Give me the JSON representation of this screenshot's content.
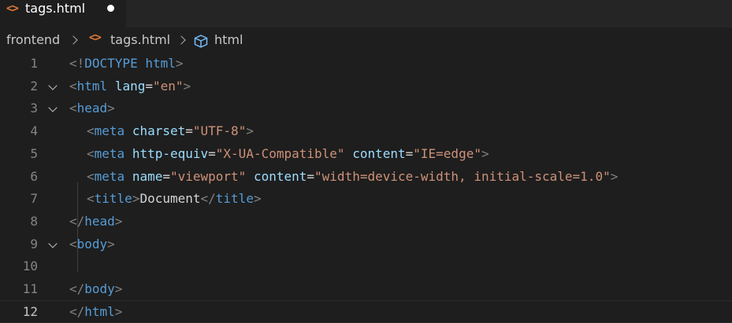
{
  "tab": {
    "icon": "<>",
    "filename": "tags.html",
    "dirty": true
  },
  "breadcrumb": {
    "folder": "frontend",
    "file_icon": "<>",
    "file": "tags.html",
    "symbol_icon": "cube-icon",
    "symbol": "html"
  },
  "editor": {
    "current_line": 12,
    "lines": [
      {
        "n": "1",
        "text": "<!DOCTYPE html>"
      },
      {
        "n": "2",
        "text": "<html lang=\"en\">"
      },
      {
        "n": "3",
        "text": "<head>"
      },
      {
        "n": "4",
        "text": "<meta charset=\"UTF-8\">"
      },
      {
        "n": "5",
        "text": "<meta http-equiv=\"X-UA-Compatible\" content=\"IE=edge\">"
      },
      {
        "n": "6",
        "text": "<meta name=\"viewport\" content=\"width=device-width, initial-scale=1.0\">"
      },
      {
        "n": "7",
        "text": "<title>Document</title>"
      },
      {
        "n": "8",
        "text": "</head>"
      },
      {
        "n": "9",
        "text": "<body>"
      },
      {
        "n": "10",
        "text": ""
      },
      {
        "n": "11",
        "text": "</body>"
      },
      {
        "n": "12",
        "text": "</html>"
      }
    ]
  },
  "colors": {
    "background": "#1e1e1e",
    "tag": "#569cd6",
    "attribute": "#9cdcfe",
    "string": "#ce9178",
    "punctuation": "#808080",
    "html_icon": "#e37933"
  }
}
